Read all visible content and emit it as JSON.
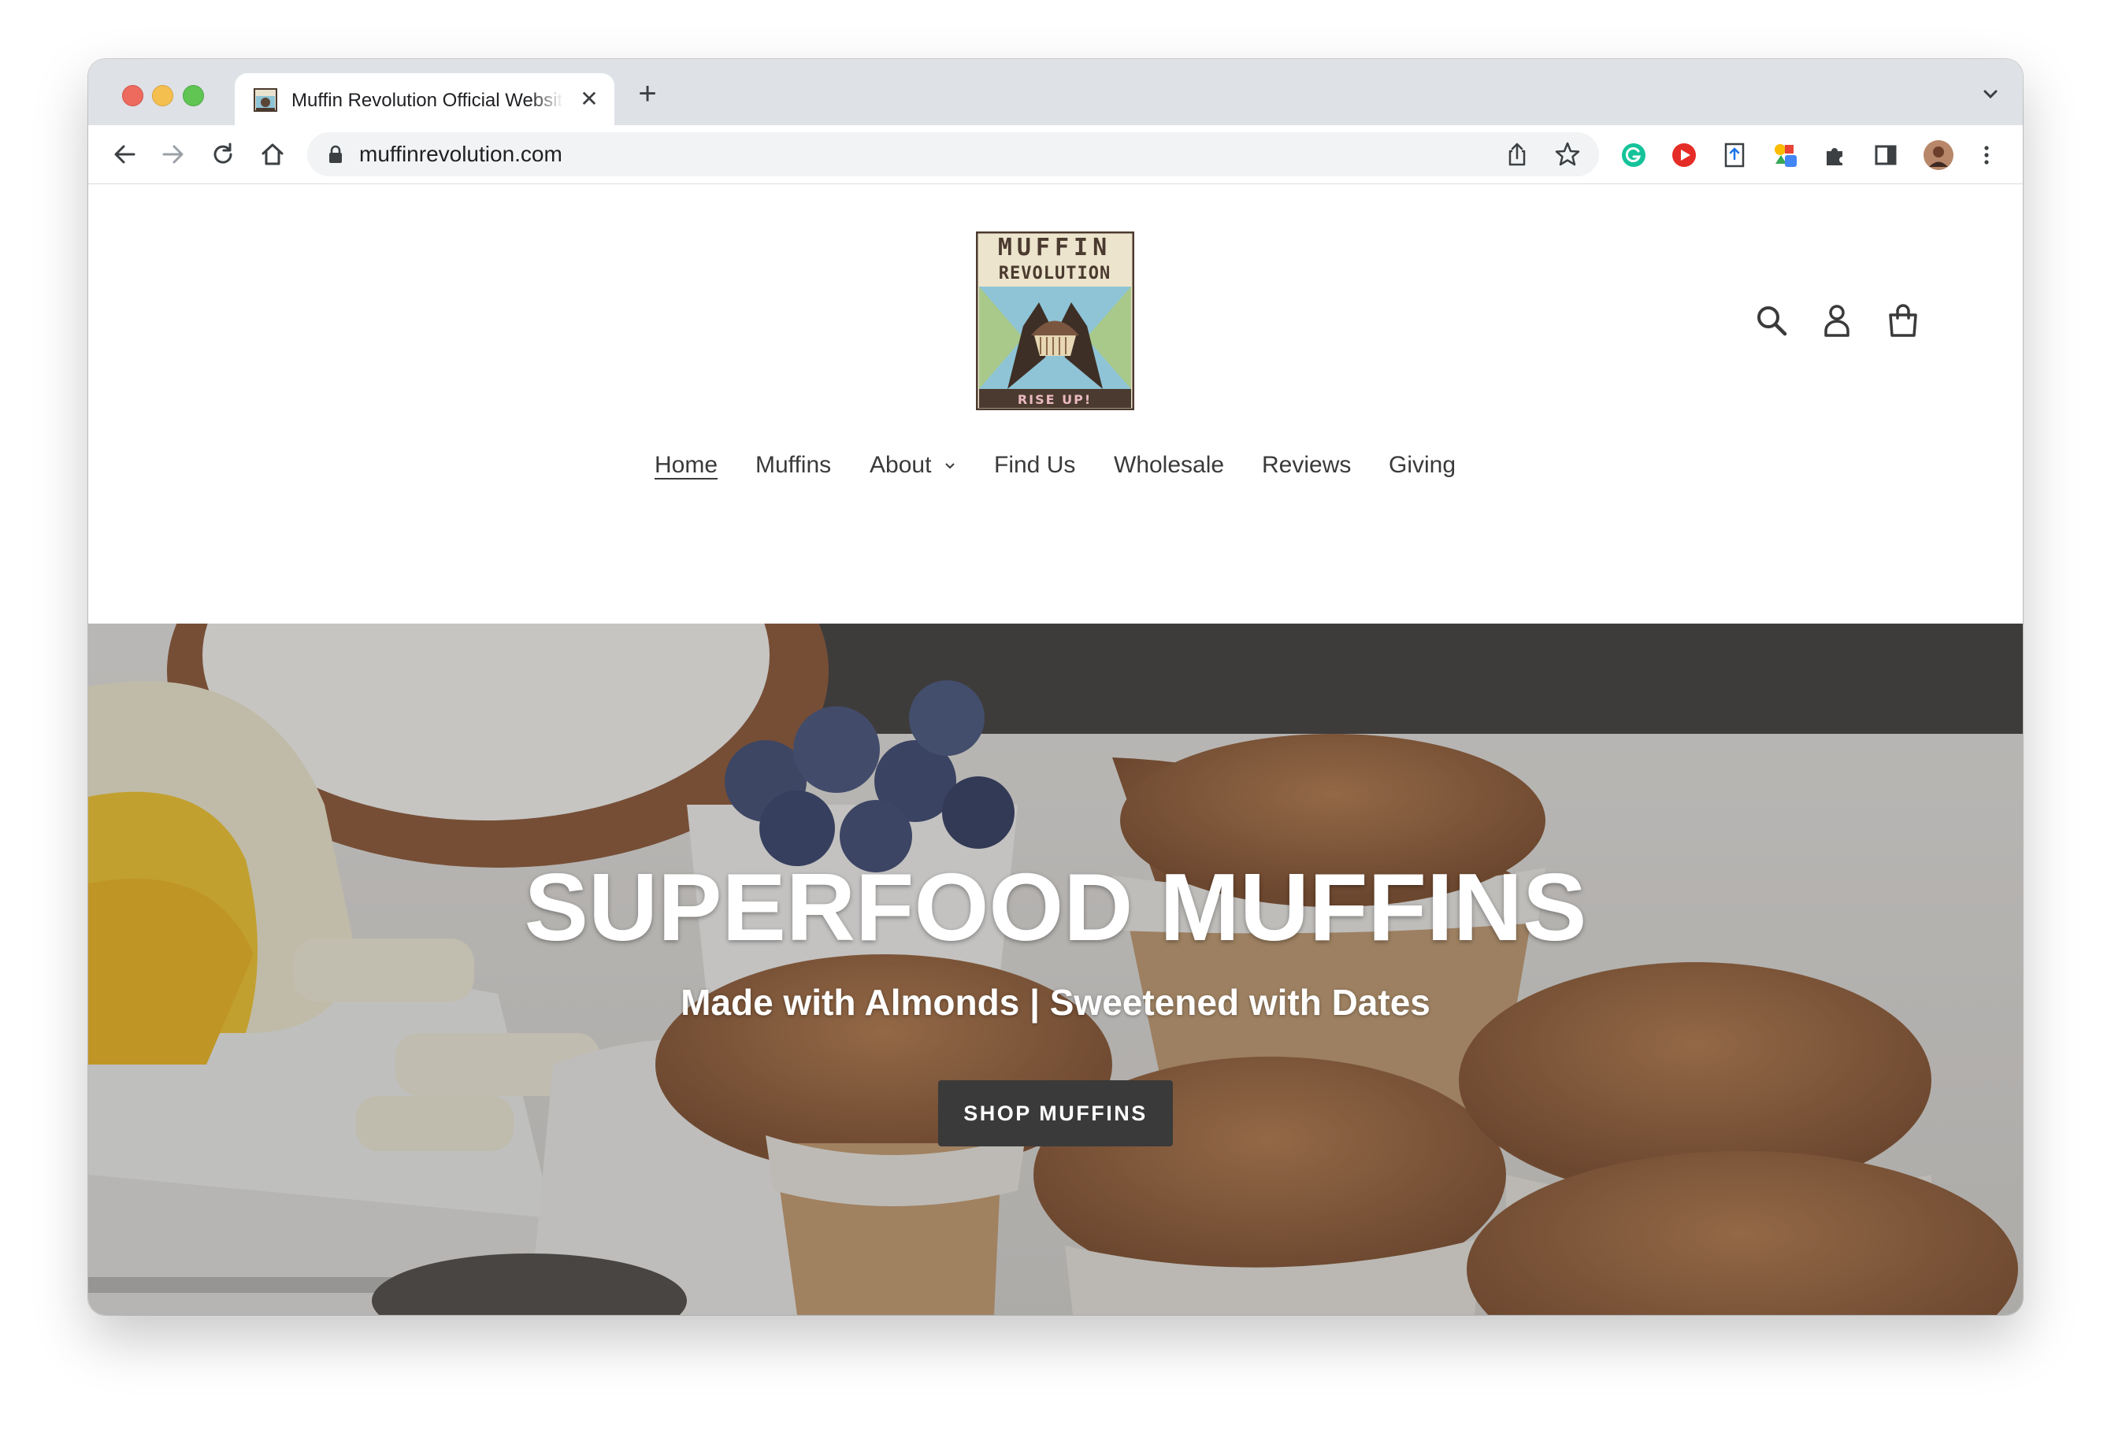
{
  "browser": {
    "tab_title": "Muffin Revolution Official Website",
    "url": "muffinrevolution.com"
  },
  "site": {
    "logo": {
      "line1": "MUFFIN",
      "line2": "REVOLUTION",
      "tagline": "RISE UP!"
    },
    "nav": [
      {
        "label": "Home"
      },
      {
        "label": "Muffins"
      },
      {
        "label": "About"
      },
      {
        "label": "Find Us"
      },
      {
        "label": "Wholesale"
      },
      {
        "label": "Reviews"
      },
      {
        "label": "Giving"
      }
    ]
  },
  "hero": {
    "title": "SUPERFOOD MUFFINS",
    "subtitle": "Made with Almonds | Sweetened with Dates",
    "button_label": "SHOP MUFFINS"
  }
}
